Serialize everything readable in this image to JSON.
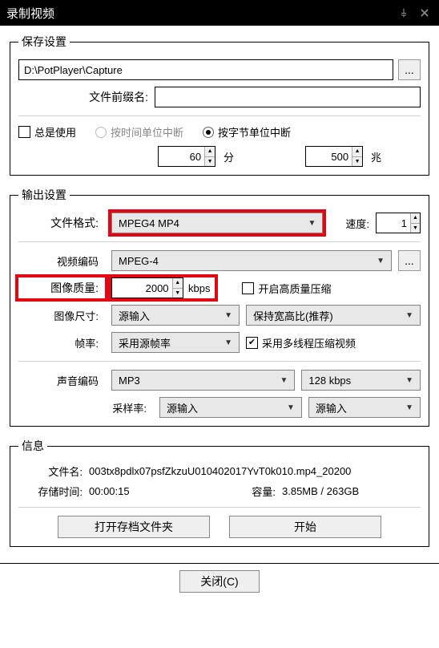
{
  "window": {
    "title": "录制视频"
  },
  "save": {
    "legend": "保存设置",
    "path": "D:\\PotPlayer\\Capture",
    "browse": "...",
    "prefix_label": "文件前缀名:",
    "prefix_value": "",
    "always_use": "总是使用",
    "radio_time": "按时间单位中断",
    "radio_bytes": "按字节单位中断",
    "time_value": "60",
    "time_unit": "分",
    "bytes_value": "500",
    "bytes_unit": "兆"
  },
  "output": {
    "legend": "输出设置",
    "format_label": "文件格式:",
    "format_value": "MPEG4 MP4",
    "speed_label": "速度:",
    "speed_value": "1",
    "venc_label": "视频编码",
    "venc_value": "MPEG-4",
    "venc_more": "...",
    "quality_label": "图像质量:",
    "quality_value": "2000",
    "quality_unit": "kbps",
    "hq_check": "开启高质量压缩",
    "size_label": "图像尺寸:",
    "size_value": "源输入",
    "aspect_value": "保持宽高比(推荐)",
    "fps_label": "帧率:",
    "fps_value": "采用源帧率",
    "multithread_check": "采用多线程压缩视频",
    "aenc_label": "声音编码",
    "aenc_value": "MP3",
    "abitrate_value": "128 kbps",
    "sample_label": "采样率:",
    "sample_value": "源输入",
    "channel_value": "源输入"
  },
  "info": {
    "legend": "信息",
    "filename_label": "文件名:",
    "filename_value": "003tx8pdlx07psfZkzuU010402017YvT0k010.mp4_20200",
    "duration_label": "存储时间:",
    "duration_value": "00:00:15",
    "capacity_label": "容量:",
    "capacity_value": "3.85MB / 263GB",
    "open_folder_btn": "打开存档文件夹",
    "start_btn": "开始"
  },
  "bottom": {
    "close": "关闭(C)"
  }
}
